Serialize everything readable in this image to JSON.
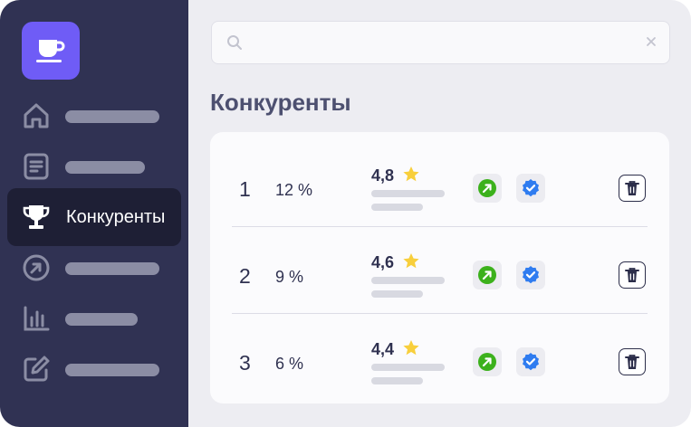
{
  "sidebar": {
    "logo_icon": "coffee-cup-icon",
    "items": [
      {
        "icon": "home-icon",
        "placeholder": true
      },
      {
        "icon": "document-icon",
        "placeholder": true
      },
      {
        "icon": "trophy-icon",
        "label": "Конкуренты",
        "active": true
      },
      {
        "icon": "arrow-circle-icon",
        "placeholder": true
      },
      {
        "icon": "bar-chart-icon",
        "placeholder": true
      },
      {
        "icon": "edit-icon",
        "placeholder": true
      }
    ]
  },
  "search": {
    "value": "",
    "placeholder": ""
  },
  "page": {
    "title": "Конкуренты"
  },
  "competitors": [
    {
      "rank": "1",
      "share": "12 %",
      "rating": "4,8"
    },
    {
      "rank": "2",
      "share": "9 %",
      "rating": "4,6"
    },
    {
      "rank": "3",
      "share": "6 %",
      "rating": "4,4"
    }
  ],
  "colors": {
    "sidebar": "#303253",
    "sidebar_active": "#1e1f35",
    "logo": "#6f5cf6",
    "growth": "#3cb11c",
    "verified": "#2f7cf0",
    "star": "#f8cf3c"
  }
}
